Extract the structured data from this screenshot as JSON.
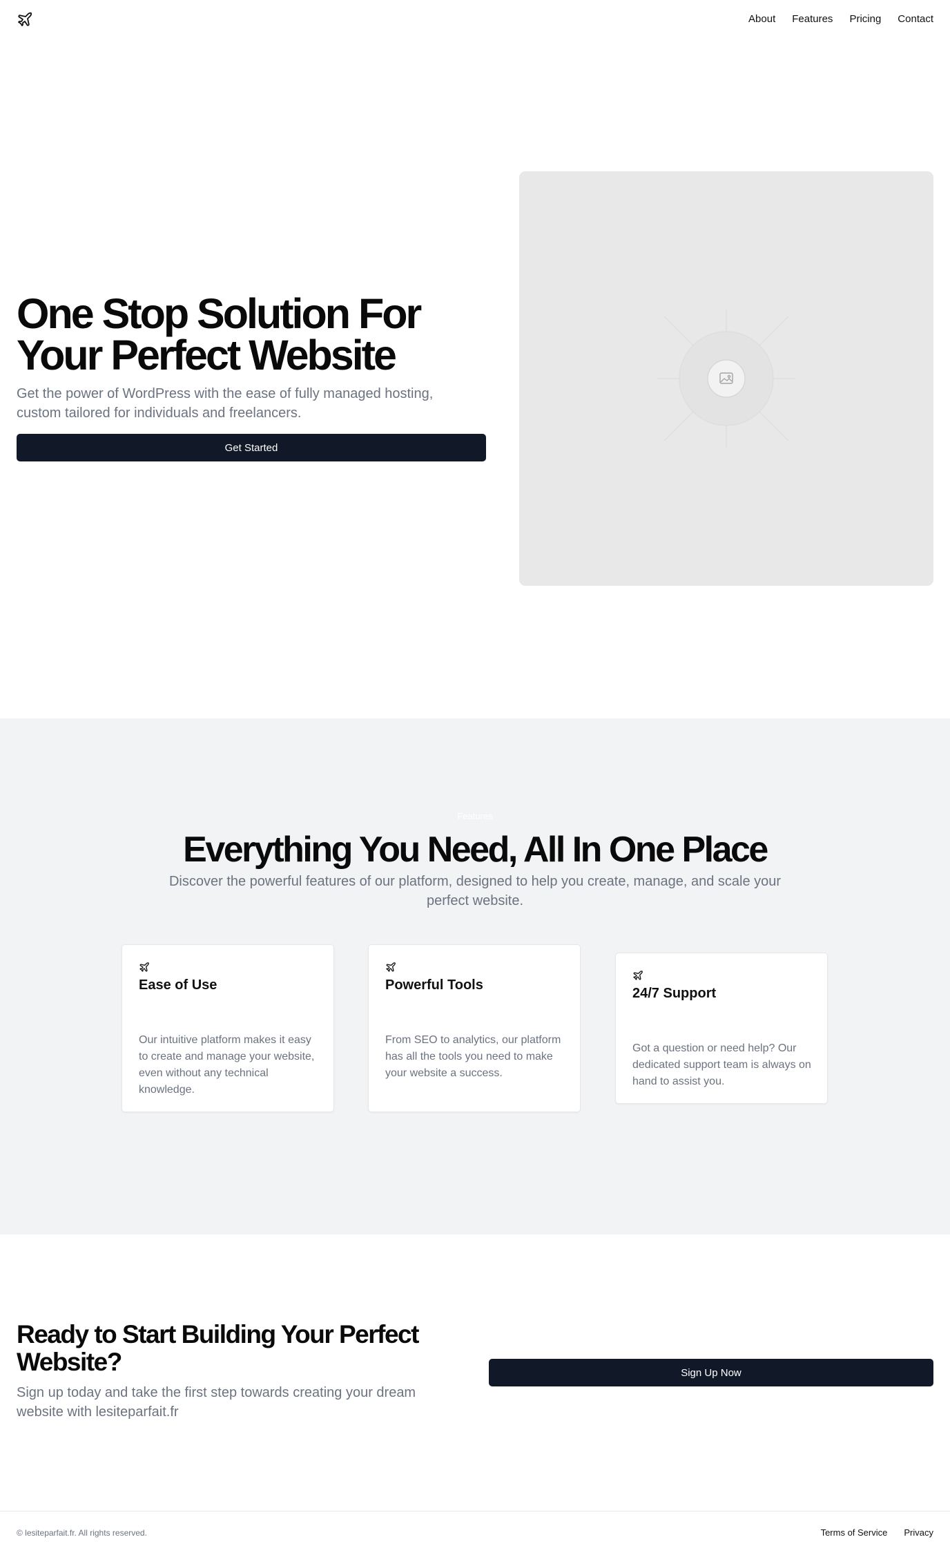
{
  "header": {
    "logo_icon": "plane-icon",
    "nav": [
      {
        "label": "About"
      },
      {
        "label": "Features"
      },
      {
        "label": "Pricing"
      },
      {
        "label": "Contact"
      }
    ]
  },
  "hero": {
    "title": "One Stop Solution For Your Perfect Website",
    "subtitle": "Get the power of WordPress with the ease of fully managed hosting, custom tailored for individuals and freelancers.",
    "button_label": "Get Started",
    "image_icon": "image-placeholder-icon"
  },
  "features": {
    "kicker": "Features",
    "title": "Everything You Need, All In One Place",
    "subtitle": "Discover the powerful features of our platform, designed to help you create, manage, and scale your perfect website.",
    "cards": [
      {
        "icon": "plane-icon",
        "title": "Ease of Use",
        "text": "Our intuitive platform makes it easy to create and manage your website, even without any technical knowledge."
      },
      {
        "icon": "plane-icon",
        "title": "Powerful Tools",
        "text": "From SEO to analytics, our platform has all the tools you need to make your website a success."
      },
      {
        "icon": "plane-icon",
        "title": "24/7 Support",
        "text": "Got a question or need help? Our dedicated support team is always on hand to assist you."
      }
    ]
  },
  "cta": {
    "title": "Ready to Start Building Your Perfect Website?",
    "subtitle": "Sign up today and take the first step towards creating your dream website with lesiteparfait.fr",
    "button_label": "Sign Up Now"
  },
  "footer": {
    "copyright": "© lesiteparfait.fr. All rights reserved.",
    "links": [
      {
        "label": "Terms of Service"
      },
      {
        "label": "Privacy"
      }
    ]
  },
  "colors": {
    "primary_button": "#111827",
    "muted_text": "#6b7280",
    "section_background": "#f2f3f5",
    "image_placeholder": "#e8e8e8"
  }
}
